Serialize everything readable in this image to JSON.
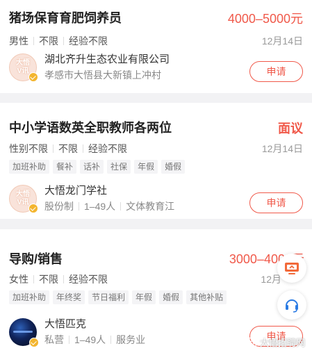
{
  "jobs": [
    {
      "title": "猪场保育育肥饲养员",
      "salary": "4000–5000元",
      "requirements": [
        "男性",
        "不限",
        "经验不限"
      ],
      "date": "12月14日",
      "tags": [],
      "company_name": "湖北齐升生态农业有限公司",
      "company_meta": [
        "孝感市大悟县大新镇上冲村"
      ],
      "logo_text": "大悟V讯",
      "apply_label": "申请"
    },
    {
      "title": "中小学语数英全职教师各两位",
      "salary": "面议",
      "requirements": [
        "性别不限",
        "不限",
        "经验不限"
      ],
      "date": "12月14日",
      "tags": [
        "加班补助",
        "餐补",
        "话补",
        "社保",
        "年假",
        "婚假"
      ],
      "company_name": "大悟龙门学社",
      "company_meta": [
        "股份制",
        "1–49人",
        "文体教育江"
      ],
      "logo_text": "大悟V讯",
      "apply_label": "申请"
    },
    {
      "title": "导购/销售",
      "salary": "3000–4000元",
      "requirements": [
        "女性",
        "不限",
        "经验不限"
      ],
      "date": "12月",
      "tags": [
        "加班补助",
        "年终奖",
        "节日福利",
        "年假",
        "婚假",
        "其他补贴"
      ],
      "company_name": "大悟匹克",
      "company_meta": [
        "私营",
        "1–49人",
        "服务业"
      ],
      "logo_text": "",
      "apply_label": "申请"
    }
  ],
  "floating": [
    "screen-share-icon",
    "headset-icon"
  ],
  "watermark": "大悟招聘网",
  "colors": {
    "accent": "#f0594a",
    "badge": "#f3b52f"
  }
}
